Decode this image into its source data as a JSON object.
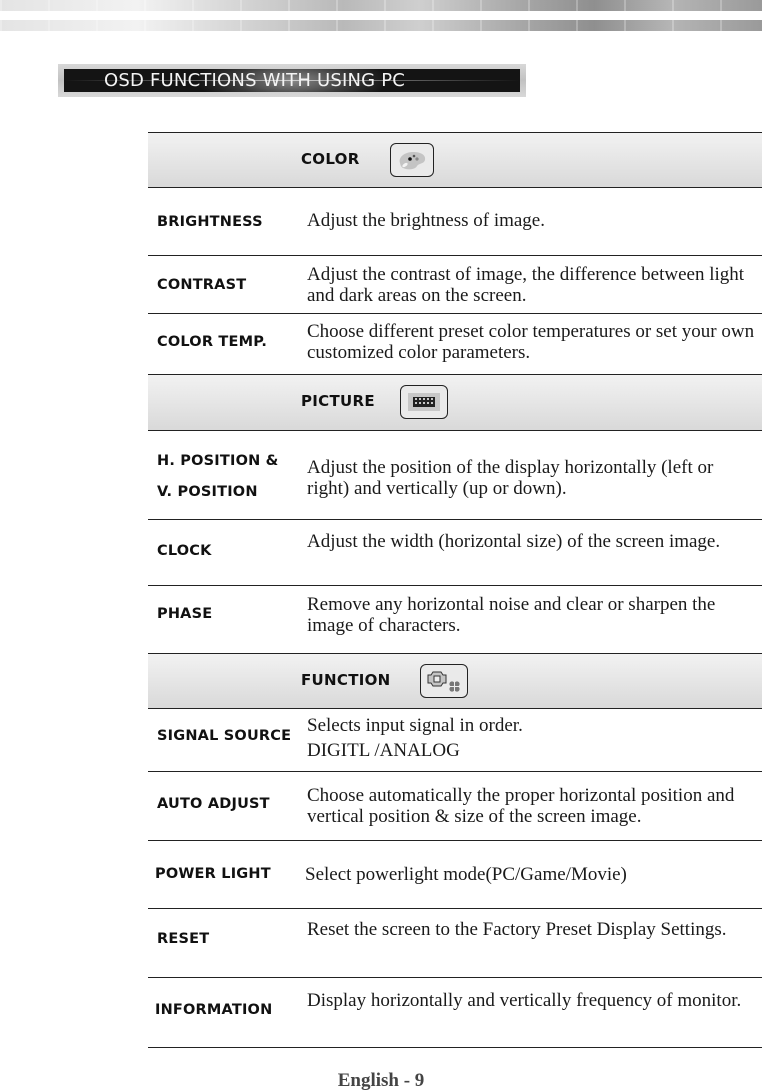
{
  "page_title": "OSD FUNCTIONS WITH USING PC",
  "sections": [
    {
      "title": "COLOR",
      "icon": "color-palette-icon",
      "rows": [
        {
          "label": "BRIGHTNESS",
          "description": "Adjust the brightness of image."
        },
        {
          "label": "CONTRAST",
          "description": "Adjust the contrast of image, the difference between light and dark areas on the screen."
        },
        {
          "label": "COLOR TEMP.",
          "description": "Choose different preset color temperatures or set your own customized color parameters."
        }
      ]
    },
    {
      "title": "PICTURE",
      "icon": "picture-grid-icon",
      "rows": [
        {
          "label": "H. POSITION &",
          "label2": "V. POSITION",
          "description": "Adjust the position of the display horizontally (left or right) and vertically (up or down)."
        },
        {
          "label": "CLOCK",
          "description": "Adjust the width (horizontal size) of the screen image."
        },
        {
          "label": "PHASE",
          "description": "Remove any horizontal noise and clear or sharpen the image of characters."
        }
      ]
    },
    {
      "title": "FUNCTION",
      "icon": "function-gear-icon",
      "rows": [
        {
          "label": "SIGNAL SOURCE",
          "description": "Selects input signal in order.",
          "description2": "DIGITL /ANALOG"
        },
        {
          "label": "AUTO ADJUST",
          "description": "Choose automatically the proper horizontal position and vertical position & size of the screen image."
        },
        {
          "label": "POWER LIGHT",
          "description": "Select  powerlight mode(PC/Game/Movie)"
        },
        {
          "label": "RESET",
          "description": "Reset the screen to the Factory Preset Display Settings."
        },
        {
          "label": "INFORMATION",
          "description": "Display horizontally and vertically frequency of monitor."
        }
      ]
    }
  ],
  "footer": "English - 9"
}
